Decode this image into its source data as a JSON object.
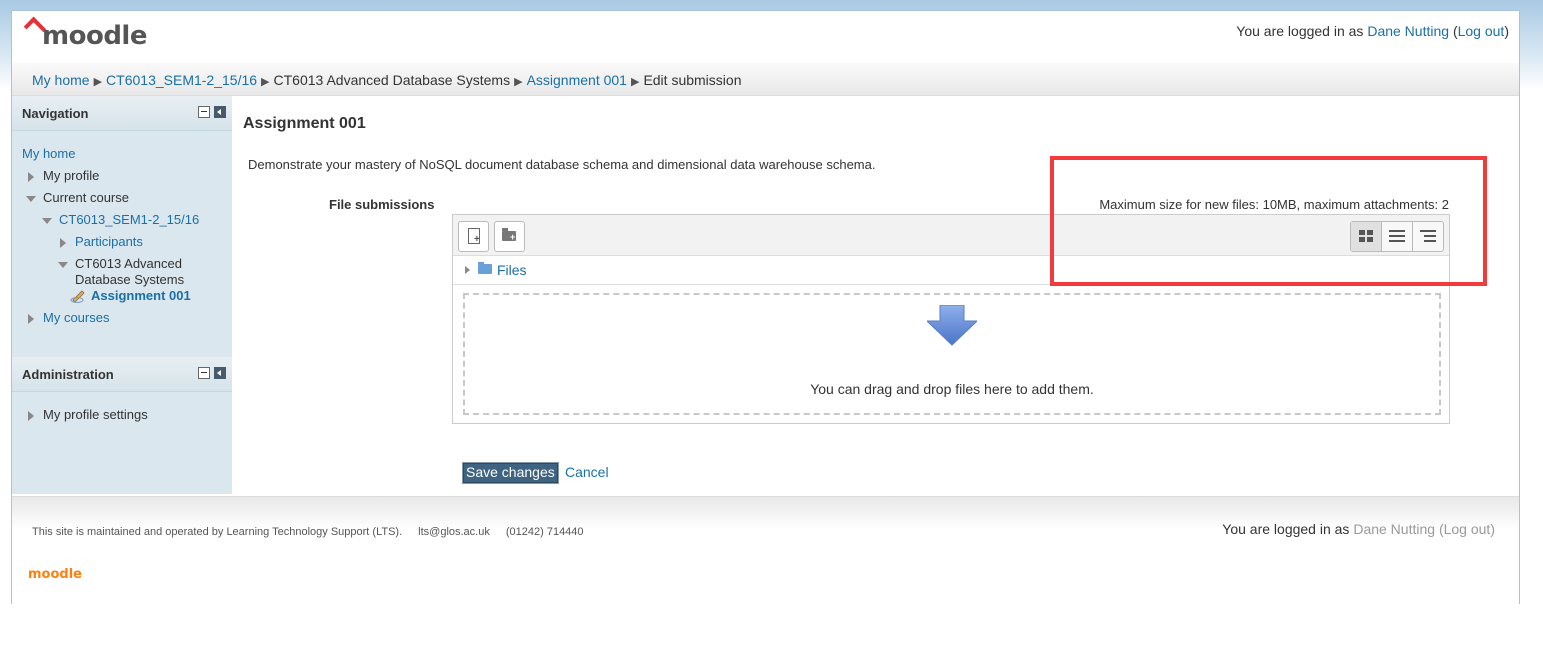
{
  "header": {
    "logo_text": "moodle",
    "logged_in_prefix": "You are logged in as",
    "user_name": "Dane Nutting",
    "logout_label": "Log out"
  },
  "breadcrumb": [
    {
      "label": "My home"
    },
    {
      "label": "CT6013_SEM1-2_15/16"
    },
    {
      "label": "CT6013 Advanced Database Systems"
    },
    {
      "label": "Assignment 001"
    },
    {
      "label": "Edit submission"
    }
  ],
  "navigation": {
    "title": "Navigation",
    "items": [
      {
        "label": "My home"
      },
      {
        "label": "My profile"
      },
      {
        "label": "Current course"
      },
      {
        "label": "CT6013_SEM1-2_15/16"
      },
      {
        "label": "Participants"
      },
      {
        "label": "CT6013 Advanced"
      },
      {
        "label": "Database Systems"
      },
      {
        "label": "Assignment 001"
      },
      {
        "label": "My courses"
      }
    ]
  },
  "administration": {
    "title": "Administration",
    "items": [
      {
        "label": "My profile settings"
      }
    ]
  },
  "main": {
    "title": "Assignment 001",
    "intro": "Demonstrate your mastery of NoSQL document database schema and dimensional data warehouse schema.",
    "file_submissions_label": "File submissions",
    "max_size_text": "Maximum size for new files: 10MB, maximum attachments: 2",
    "files_path_label": "Files",
    "drop_text": "You can drag and drop files here to add them.",
    "save_label": "Save changes",
    "cancel_label": "Cancel"
  },
  "footer": {
    "maintained_text": "This site is maintained and operated by Learning Technology Support (LTS).",
    "email": "lts@glos.ac.uk",
    "phone": "(01242) 714440",
    "logged_in_prefix": "You are logged in as",
    "user_name": "Dane Nutting",
    "logout_label": "Log out",
    "logo_text": "moodle"
  },
  "colors": {
    "link": "#1a6fa8",
    "annotation": "#f23b3b",
    "save_button": "#3e6482",
    "brand_orange": "#f98012"
  }
}
